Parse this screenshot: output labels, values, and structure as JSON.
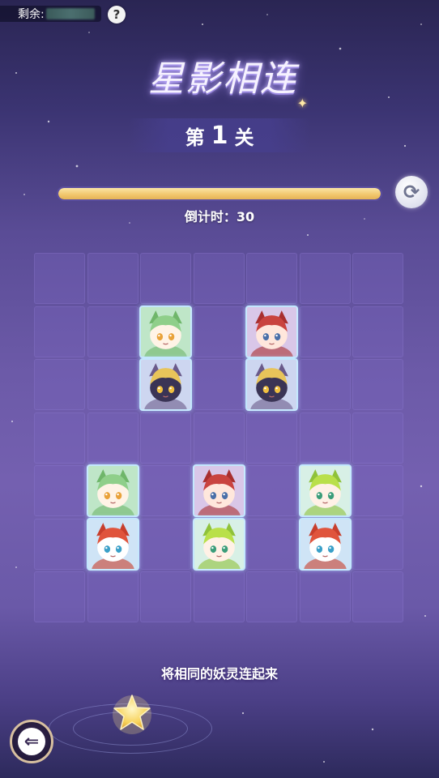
{
  "topbar": {
    "remain_label": "剩余:",
    "help_icon": "question-icon",
    "help_text": "?"
  },
  "title": {
    "text": "星影相连"
  },
  "level": {
    "prefix": "第",
    "number": "1",
    "suffix": "关"
  },
  "timer": {
    "label": "倒计时：",
    "value": "30",
    "progress": 1.0
  },
  "refresh": {
    "icon": "refresh-icon",
    "glyph": "⟳"
  },
  "board": {
    "rows": 7,
    "cols": 7,
    "tiles": [
      {
        "row": 1,
        "col": 2,
        "spirit": "green-cat"
      },
      {
        "row": 1,
        "col": 4,
        "spirit": "red-hair"
      },
      {
        "row": 2,
        "col": 2,
        "spirit": "masked-yellow"
      },
      {
        "row": 2,
        "col": 4,
        "spirit": "masked-yellow"
      },
      {
        "row": 4,
        "col": 1,
        "spirit": "green-cat"
      },
      {
        "row": 4,
        "col": 3,
        "spirit": "red-hair"
      },
      {
        "row": 4,
        "col": 5,
        "spirit": "lime-hair"
      },
      {
        "row": 5,
        "col": 1,
        "spirit": "red-fox"
      },
      {
        "row": 5,
        "col": 3,
        "spirit": "lime-hair"
      },
      {
        "row": 5,
        "col": 5,
        "spirit": "red-fox"
      }
    ]
  },
  "hint": {
    "text": "将相同的妖灵连起来"
  },
  "back": {
    "icon": "back-arrow-icon",
    "glyph": "⇐"
  },
  "colors": {
    "progress_fill": "#f1c86f",
    "tile_border": "#c8ebff",
    "board_cell": "#7864be"
  }
}
